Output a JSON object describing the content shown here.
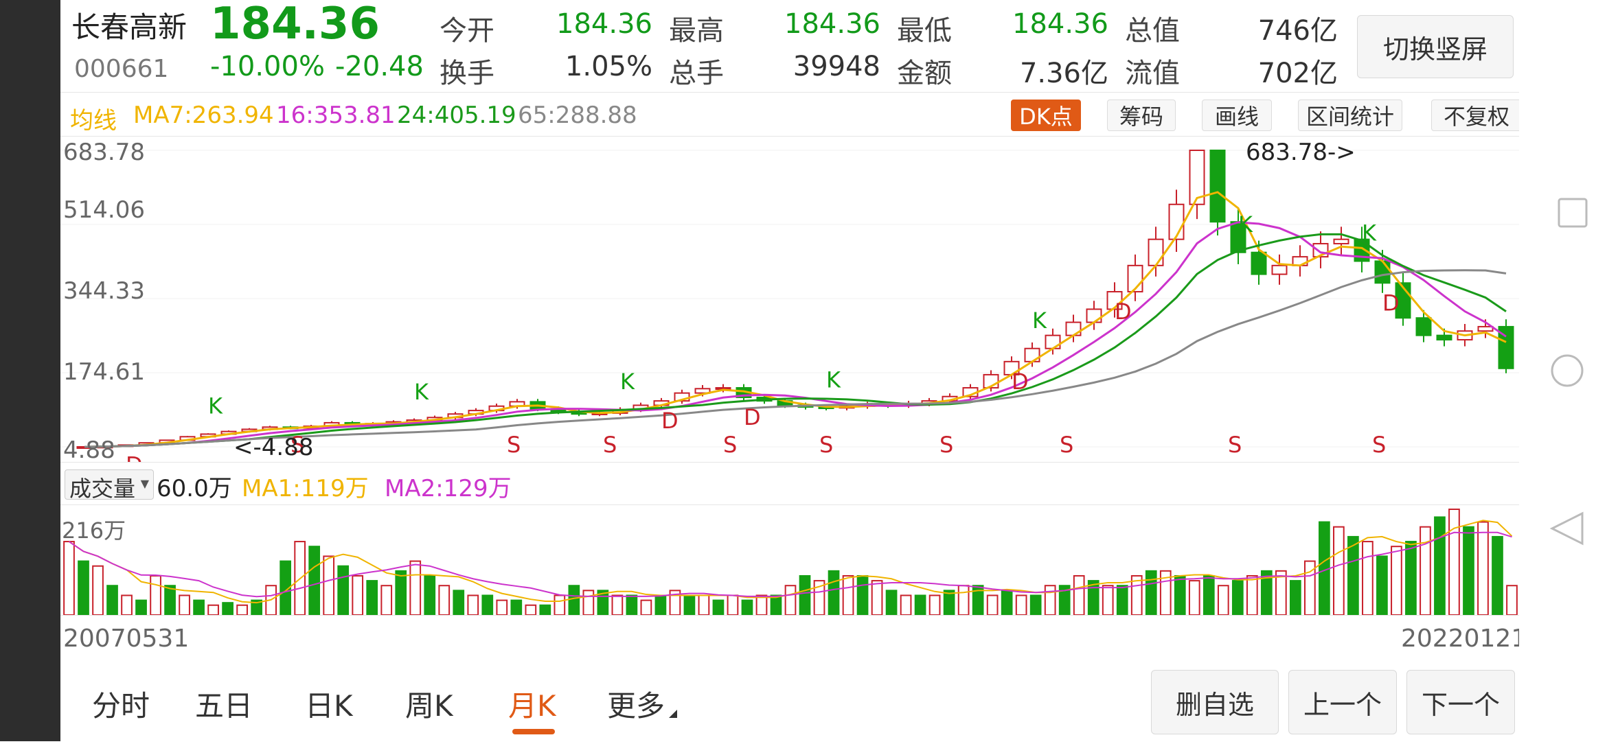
{
  "stock": {
    "name": "长春高新",
    "code": "000661",
    "price": "184.36",
    "change_pct": "-10.00%",
    "change": "-20.48"
  },
  "stats": {
    "open_label": "今开",
    "open": "184.36",
    "high_label": "最高",
    "high": "184.36",
    "low_label": "最低",
    "low": "184.36",
    "mcap_label": "总值",
    "mcap": "746亿",
    "turnover_label": "换手",
    "turnover": "1.05%",
    "vol_label": "总手",
    "vol": "39948",
    "amount_label": "金额",
    "amount": "7.36亿",
    "float_label": "流值",
    "float": "702亿"
  },
  "orient_button": "切换竖屏",
  "ma_bar": {
    "label": "均线",
    "ma7": "MA7:263.94",
    "ma16": "16:353.81",
    "ma24": "24:405.19",
    "ma65": "65:288.88"
  },
  "chart_tools": [
    "DK点",
    "筹码",
    "画线",
    "区间统计",
    "不复权"
  ],
  "price_axis": [
    "683.78",
    "514.06",
    "344.33",
    "174.61",
    "4.88"
  ],
  "annotations": {
    "high_marker": "683.78->",
    "low_marker": "<-4.88"
  },
  "volume": {
    "selector": "成交量",
    "value": "60.0万",
    "ma1": "MA1:119万",
    "ma2": "MA2:129万",
    "axis_max": "216万"
  },
  "date_range": {
    "start": "20070531",
    "end": "20220121"
  },
  "period_tabs": [
    "分时",
    "五日",
    "日K",
    "周K",
    "月K",
    "更多"
  ],
  "active_tab": "月K",
  "actions": [
    "删自选",
    "上一个",
    "下一个"
  ],
  "colors": {
    "up": "#c8202a",
    "down": "#14a014",
    "ma7": "#f0b400",
    "ma16": "#cc33cc",
    "ma24": "#1a9a1a",
    "ma65": "#888888",
    "accent": "#e05a16"
  },
  "signal_labels": {
    "buy": "K",
    "sell": "S",
    "dip": "D"
  },
  "chart_data": [
    {
      "type": "candlestick",
      "title": "",
      "x_start": "20070531",
      "x_end": "20220121",
      "ylim": [
        4.88,
        683.78
      ],
      "y_ticks": [
        683.78,
        514.06,
        344.33,
        174.61,
        4.88
      ],
      "close_trend": [
        4.88,
        6,
        9,
        14,
        20,
        28,
        34,
        40,
        45,
        50,
        48,
        52,
        60,
        55,
        58,
        62,
        66,
        72,
        80,
        88,
        98,
        108,
        92,
        85,
        80,
        82,
        90,
        100,
        110,
        128,
        138,
        140,
        118,
        110,
        100,
        96,
        94,
        98,
        102,
        100,
        104,
        110,
        120,
        140,
        170,
        200,
        230,
        260,
        290,
        320,
        360,
        420,
        480,
        560,
        683.78,
        520,
        450,
        400,
        420,
        440,
        470,
        480,
        430,
        380,
        300,
        260,
        250,
        270,
        280,
        184.36
      ],
      "current": 184.36
    },
    {
      "type": "bar",
      "title": "",
      "ylim": [
        0,
        216
      ],
      "unit": "万",
      "values": [
        150,
        110,
        100,
        60,
        40,
        30,
        80,
        60,
        40,
        30,
        20,
        25,
        20,
        30,
        60,
        110,
        150,
        140,
        120,
        100,
        80,
        70,
        60,
        90,
        110,
        80,
        60,
        50,
        40,
        40,
        30,
        30,
        20,
        20,
        40,
        60,
        50,
        50,
        40,
        40,
        30,
        40,
        50,
        40,
        40,
        30,
        40,
        30,
        40,
        40,
        60,
        80,
        70,
        90,
        80,
        80,
        70,
        50,
        40,
        40,
        40,
        50,
        60,
        60,
        40,
        50,
        40,
        40,
        60,
        60,
        80,
        70,
        60,
        60,
        80,
        90,
        90,
        80,
        70,
        80,
        60,
        70,
        80,
        90,
        90,
        70,
        110,
        190,
        180,
        160,
        150,
        120,
        140,
        150,
        180,
        200,
        216,
        180,
        190,
        160,
        60
      ],
      "up_pattern": "alternating"
    }
  ]
}
